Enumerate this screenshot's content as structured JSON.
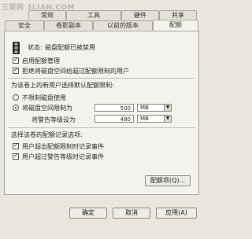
{
  "watermark": "三联网 3LIAN.COM",
  "tabs_row1": [
    {
      "label": "常规"
    },
    {
      "label": "工具"
    },
    {
      "label": "硬件"
    },
    {
      "label": "共享"
    }
  ],
  "tabs_row2": [
    {
      "label": "安全"
    },
    {
      "label": "卷影副本"
    },
    {
      "label": "以前的版本"
    },
    {
      "label": "配额",
      "active": true
    }
  ],
  "status": {
    "label": "状态:",
    "text": "磁盘配额已被禁用"
  },
  "options": {
    "enable_quota": {
      "label": "启用配额管理",
      "checked": true
    },
    "deny_space": {
      "label": "拒绝将磁盘空间给超过配额限制的用户",
      "checked": true
    }
  },
  "new_user_section": {
    "heading": "为该卷上的新用户选择默认配额限制:",
    "no_limit": {
      "label": "不限制磁盘使用",
      "selected": false
    },
    "limit_space": {
      "label": "将磁盘空间限制为",
      "selected": true,
      "value": "500",
      "unit": "MB"
    },
    "warning_level": {
      "label": "将警告等级设为",
      "value": "480",
      "unit": "MB"
    }
  },
  "logging_section": {
    "heading": "选择该卷的配额记录选项:",
    "log_over_limit": {
      "label": "用户超出配额限制时记录事件",
      "checked": true
    },
    "log_over_warning": {
      "label": "用户超过警告等级时记录事件",
      "checked": true
    }
  },
  "quota_entries_button": "配额项(Q)...",
  "footer": {
    "ok": "确定",
    "cancel": "取消",
    "apply": "应用(A)"
  },
  "colors": {
    "dialog_bg": "#e9e6dd",
    "panel_bg": "#f4f2ec",
    "traffic_light_body": "#222222"
  },
  "icons": {
    "traffic_light": "traffic-light-icon",
    "dropdown_arrow": "chevron-down-icon"
  }
}
